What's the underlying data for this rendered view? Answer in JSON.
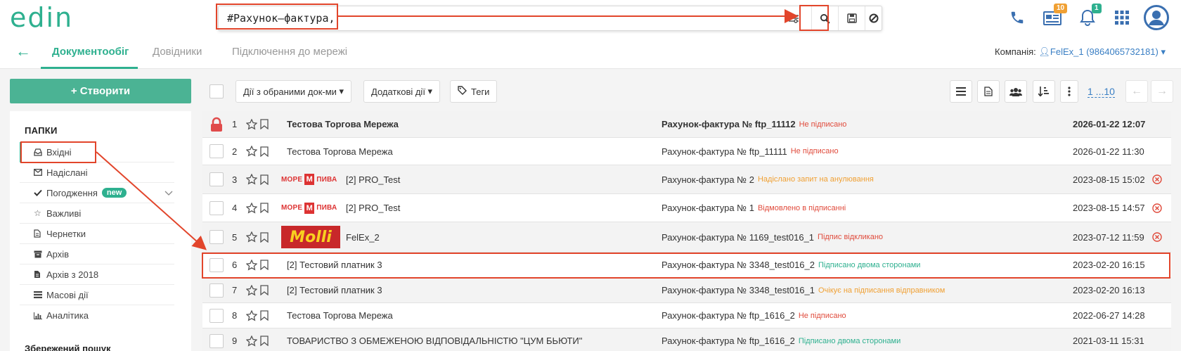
{
  "header": {
    "logo": "edin",
    "search_value": "#Рахунок–фактура,",
    "notifications_news_count": "10",
    "notifications_bell_count": "1"
  },
  "nav": {
    "tabs": [
      {
        "label": "Документообіг"
      },
      {
        "label": "Довідники"
      },
      {
        "label": "Підключення до мережі"
      }
    ],
    "company_label": "Компанія:",
    "company_value": "FelEx_1 (9864065732181)"
  },
  "sidebar": {
    "create_label": "+ Створити",
    "folders_title": "ПАПКИ",
    "folders": [
      {
        "label": "Вхідні",
        "icon": "inbox-icon"
      },
      {
        "label": "Надіслані",
        "icon": "envelope-icon"
      },
      {
        "label": "Погодження",
        "icon": "check-icon",
        "badge": "new"
      },
      {
        "label": "Важливі",
        "icon": "star-icon"
      },
      {
        "label": "Чернетки",
        "icon": "file-icon"
      },
      {
        "label": "Архів",
        "icon": "archive-icon"
      },
      {
        "label": "Архів з 2018",
        "icon": "file-icon"
      },
      {
        "label": "Масові дії",
        "icon": "list-icon"
      },
      {
        "label": "Аналітика",
        "icon": "chart-icon"
      }
    ],
    "saved_search_title": "Збережений пошук"
  },
  "toolbar": {
    "bulk_actions": "Дії з обраними док-ми",
    "extra_actions": "Додаткові дії",
    "tags": "Теги",
    "pager": "1 ...10"
  },
  "rows": [
    {
      "num": "1",
      "company": "Тестова Торгова Мережа",
      "doc": "Рахунок-фактура № ftp_11112",
      "status": "Не підписано",
      "status_type": "red",
      "date": "2026-01-22 12:07",
      "bold": true,
      "locked": true
    },
    {
      "num": "2",
      "company": "Тестова Торгова Мережа",
      "doc": "Рахунок-фактура № ftp_11111",
      "status": "Не підписано",
      "status_type": "red",
      "date": "2026-01-22 11:30"
    },
    {
      "num": "3",
      "company": "[2] PRO_Test",
      "doc": "Рахунок-фактура № 2",
      "status": "Надіслано запит на анулювання",
      "status_type": "orange",
      "date": "2023-08-15 15:02",
      "logo": "more",
      "cancel": true
    },
    {
      "num": "4",
      "company": "[2] PRO_Test",
      "doc": "Рахунок-фактура № 1",
      "status": "Відмовлено в підписанні",
      "status_type": "red",
      "date": "2023-08-15 14:57",
      "logo": "more",
      "cancel": true
    },
    {
      "num": "5",
      "company": "FelEx_2",
      "doc": "Рахунок-фактура № 1169_test016_1",
      "status": "Підпис відкликано",
      "status_type": "red",
      "date": "2023-07-12 11:59",
      "logo": "molli",
      "cancel": true
    },
    {
      "num": "6",
      "company": "[2] Тестовий платник 3",
      "doc": "Рахунок-фактура № 3348_test016_2",
      "status": "Підписано двома сторонами",
      "status_type": "green",
      "date": "2023-02-20 16:15"
    },
    {
      "num": "7",
      "company": "[2] Тестовий платник 3",
      "doc": "Рахунок-фактура № 3348_test016_1",
      "status": "Очікує на підписання відправником",
      "status_type": "orange",
      "date": "2023-02-20 16:13"
    },
    {
      "num": "8",
      "company": "Тестова Торгова Мережа",
      "doc": "Рахунок-фактура № ftp_1616_2",
      "status": "Не підписано",
      "status_type": "red",
      "date": "2022-06-27 14:28"
    },
    {
      "num": "9",
      "company": "ТОВАРИСТВО З ОБМЕЖЕНОЮ ВІДПОВІДАЛЬНІСТЮ \"ЦУМ БЬЮТИ\"",
      "doc": "Рахунок-фактура № ftp_1616_2",
      "status": "Підписано двома сторонами",
      "status_type": "green",
      "date": "2021-03-11 15:31"
    }
  ],
  "logos": {
    "more_left": "МОРЕ",
    "more_mid": "М",
    "more_right": "ПИВА",
    "molli": "Molli"
  },
  "colors": {
    "accent": "#2eb08f",
    "highlight": "#e2452b",
    "link": "#3a7fc4"
  }
}
